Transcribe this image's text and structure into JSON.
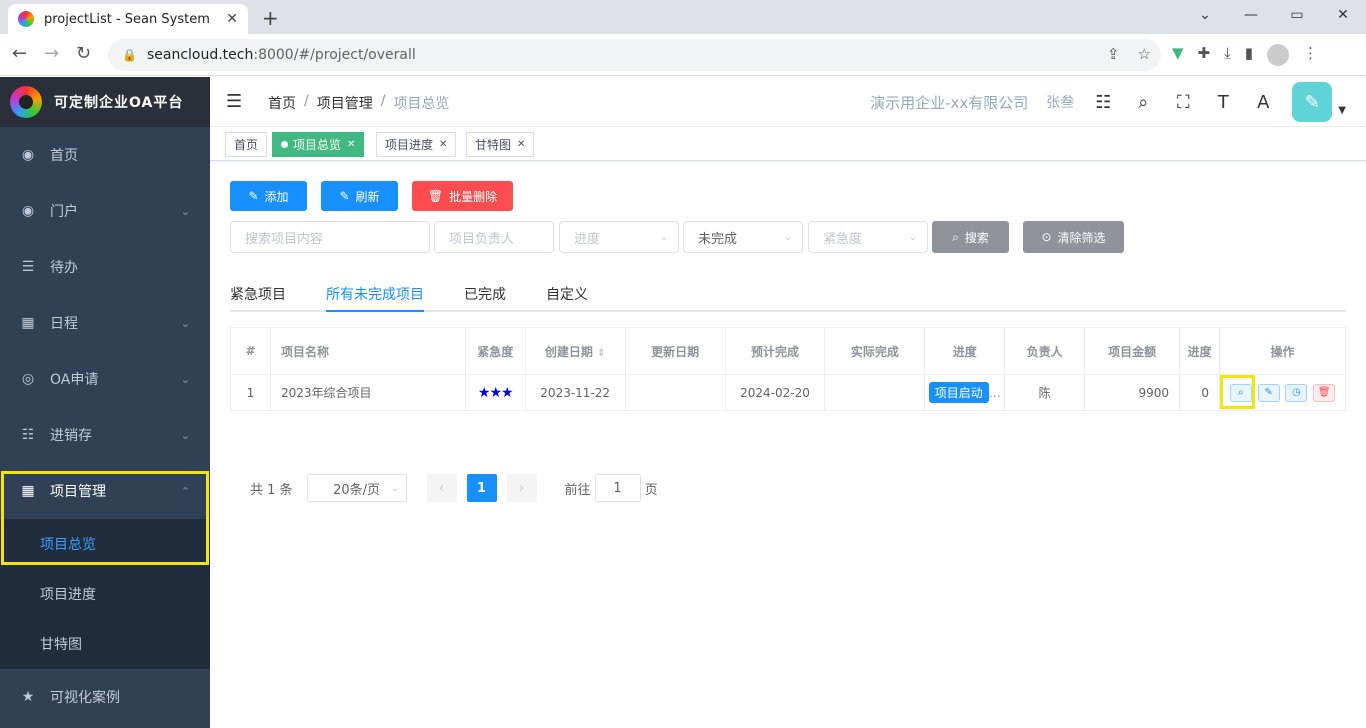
{
  "browser": {
    "tab_title": "projectList - Sean System",
    "url_host": "seancloud.tech",
    "url_rest": ":8000/#/project/overall",
    "close": "✕",
    "newtab": "+",
    "win_min": "⌄",
    "win_restore": "▭",
    "win_close": "✕"
  },
  "sidebar": {
    "logo_text": "可定制企业OA平台",
    "items": [
      {
        "label": "首页",
        "icon": "dashboard-icon",
        "glyph": "◉"
      },
      {
        "label": "门户",
        "icon": "dashboard-icon",
        "glyph": "◉"
      },
      {
        "label": "待办",
        "icon": "list-icon",
        "glyph": "☰"
      },
      {
        "label": "日程",
        "icon": "grid-icon",
        "glyph": "▦"
      },
      {
        "label": "OA申请",
        "icon": "circle-icon",
        "glyph": "◎"
      },
      {
        "label": "进销存",
        "icon": "list-tree-icon",
        "glyph": "☷"
      },
      {
        "label": "项目管理",
        "icon": "table-icon",
        "glyph": "▦"
      }
    ],
    "sub_items": [
      "项目总览",
      "项目进度",
      "甘特图"
    ],
    "last_item": {
      "label": "可视化案例",
      "icon": "star-icon",
      "glyph": "★"
    }
  },
  "navbar": {
    "breadcrumb": [
      "首页",
      "项目管理",
      "项目总览"
    ],
    "breadcrumb_sep": "/",
    "company": "演示用企业-xx有限公司",
    "user": "张叁"
  },
  "tags": [
    {
      "label": "首页"
    },
    {
      "label": "项目总览"
    },
    {
      "label": "项目进度"
    },
    {
      "label": "甘特图"
    }
  ],
  "toolbar": {
    "add": "添加",
    "refresh": "刷新",
    "batch_delete": "批量删除",
    "search": "搜索",
    "clear": "清除筛选"
  },
  "filters": {
    "search_placeholder": "搜索项目内容",
    "owner_placeholder": "项目负责人",
    "progress_placeholder": "进度",
    "status_value": "未完成",
    "urgency_placeholder": "紧急度"
  },
  "tabs": [
    "紧急项目",
    "所有未完成项目",
    "已完成",
    "自定义"
  ],
  "table": {
    "headers": [
      "#",
      "项目名称",
      "紧急度",
      "创建日期",
      "更新日期",
      "预计完成",
      "实际完成",
      "进度",
      "负责人",
      "项目金额",
      "进度",
      "操作"
    ],
    "rows": [
      {
        "idx": "1",
        "name": "2023年综合项目",
        "stars": "★★★",
        "created": "2023-11-22",
        "updated": "",
        "expected": "2024-02-20",
        "actual": "",
        "stage": "项目启动",
        "owner": "陈",
        "amount": "9900",
        "progress": "0"
      }
    ]
  },
  "pagination": {
    "total": "共 1 条",
    "page_size": "20条/页",
    "current": "1",
    "goto_label": "前往",
    "goto_value": "1",
    "page_suffix": "页"
  }
}
